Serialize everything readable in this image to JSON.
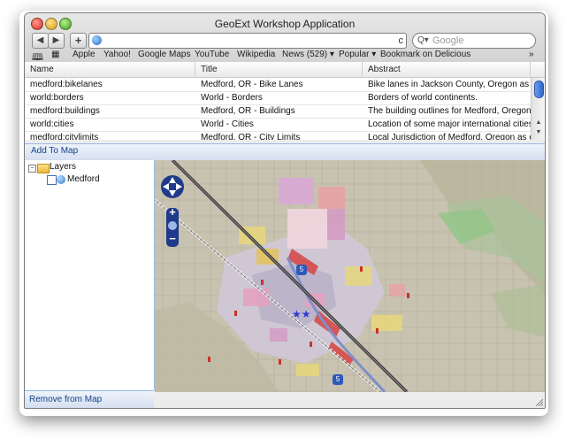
{
  "window": {
    "title": "GeoExt Workshop Application"
  },
  "toolbar": {
    "back": "◀",
    "forward": "▶",
    "add": "+",
    "reload": "c"
  },
  "search": {
    "placeholder": "Google"
  },
  "bookmarks": [
    "Apple",
    "Yahoo!",
    "Google Maps",
    "YouTube",
    "Wikipedia",
    "News (529) ▾",
    "Popular ▾",
    "Bookmark on Delicious"
  ],
  "grid": {
    "columns": [
      "Name",
      "Title",
      "Abstract"
    ],
    "rows": [
      [
        "medford:bikelanes",
        "Medford, OR - Bike Lanes",
        "Bike lanes in Jackson County, Oregon as of Dec..."
      ],
      [
        "world:borders",
        "World - Borders",
        "Borders of world continents."
      ],
      [
        "medford:buildings",
        "Medford, OR - Buildings",
        "The building outlines for Medford, Oregon as of ..."
      ],
      [
        "world:cities",
        "World - Cities",
        "Location of some major international cities."
      ],
      [
        "medford:citylimits",
        "Medford, OR - City Limits",
        "Local Jurisdiction of Medford, Oregon as of July..."
      ]
    ]
  },
  "actions": {
    "add_to_map": "Add To Map",
    "remove_from_map": "Remove from Map"
  },
  "tree": {
    "root": "Layers",
    "root_expander": "−",
    "layers": [
      "Medford"
    ]
  },
  "map": {
    "highway_label": "5",
    "zoom_in": "+",
    "zoom_out": "−"
  },
  "colors": {
    "ext_blue_border": "#99bbe8",
    "ext_blue_text": "#15428b",
    "scroll_blue": "#2f66c8"
  }
}
